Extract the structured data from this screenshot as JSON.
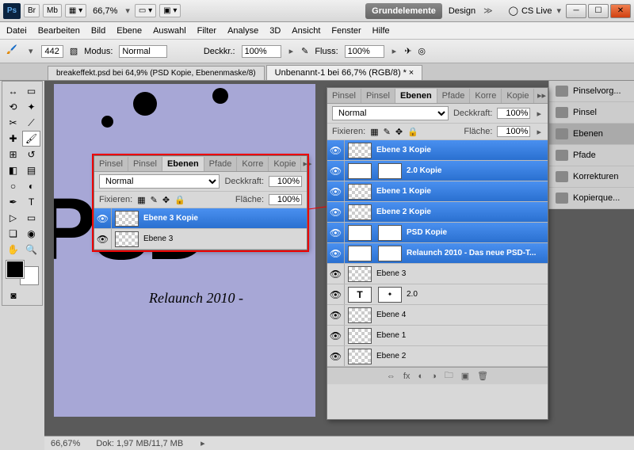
{
  "titlebar": {
    "zoom": "66,7%"
  },
  "workspace": {
    "current": "Grundelemente",
    "alt": "Design",
    "cslive": "CS Live"
  },
  "menu": [
    "Datei",
    "Bearbeiten",
    "Bild",
    "Ebene",
    "Auswahl",
    "Filter",
    "Analyse",
    "3D",
    "Ansicht",
    "Fenster",
    "Hilfe"
  ],
  "options": {
    "brushsize": "442",
    "modus_label": "Modus:",
    "modus_value": "Normal",
    "deckkr_label": "Deckkr.:",
    "deckkr_value": "100%",
    "fluss_label": "Fluss:",
    "fluss_value": "100%"
  },
  "docTabs": [
    "breakeffekt.psd bei 64,9% (PSD Kopie, Ebenenmaske/8)",
    "Unbenannt-1 bei 66,7% (RGB/8) *"
  ],
  "floatPanel": {
    "tabs": [
      "Pinsel",
      "Pinsel",
      "Ebenen",
      "Pfade",
      "Korre",
      "Kopie"
    ],
    "blend": "Normal",
    "deckkraft_label": "Deckkraft:",
    "deckkraft": "100%",
    "fix_label": "Fixieren:",
    "flaeche_label": "Fläche:",
    "flaeche": "100%",
    "layers": [
      {
        "name": "Ebene 3 Kopie",
        "sel": true
      },
      {
        "name": "Ebene 3",
        "sel": false
      }
    ]
  },
  "mainPanel": {
    "tabs": [
      "Pinsel",
      "Pinsel",
      "Ebenen",
      "Pfade",
      "Korre",
      "Kopie"
    ],
    "blend": "Normal",
    "deckkraft_label": "Deckkraft:",
    "deckkraft": "100%",
    "fix_label": "Fixieren:",
    "flaeche_label": "Fläche:",
    "flaeche": "100%",
    "layers": [
      {
        "name": "Ebene 3 Kopie",
        "sel": true,
        "type": "bmp"
      },
      {
        "name": "2.0 Kopie",
        "sel": true,
        "type": "text"
      },
      {
        "name": "Ebene 1 Kopie",
        "sel": true,
        "type": "bmp"
      },
      {
        "name": "Ebene 2 Kopie",
        "sel": true,
        "type": "bmp"
      },
      {
        "name": "PSD Kopie",
        "sel": true,
        "type": "text"
      },
      {
        "name": "Relaunch 2010 - Das neue PSD-T...",
        "sel": true,
        "type": "text"
      },
      {
        "name": "Ebene 3",
        "sel": false,
        "type": "bmp"
      },
      {
        "name": "2.0",
        "sel": false,
        "type": "text"
      },
      {
        "name": "Ebene 4",
        "sel": false,
        "type": "bmp"
      },
      {
        "name": "Ebene 1",
        "sel": false,
        "type": "bmp"
      },
      {
        "name": "Ebene 2",
        "sel": false,
        "type": "bmp"
      }
    ]
  },
  "dock": [
    {
      "label": "Pinselvorg..."
    },
    {
      "label": "Pinsel"
    },
    {
      "label": "Ebenen"
    },
    {
      "label": "Pfade"
    },
    {
      "label": "Korrekturen"
    },
    {
      "label": "Kopierque..."
    }
  ],
  "status": {
    "zoom": "66,67%",
    "dok_label": "Dok:",
    "dok": "1,97 MB/11,7 MB"
  },
  "canvas": {
    "big": "PSD",
    "sub": "Relaunch 2010 -"
  }
}
